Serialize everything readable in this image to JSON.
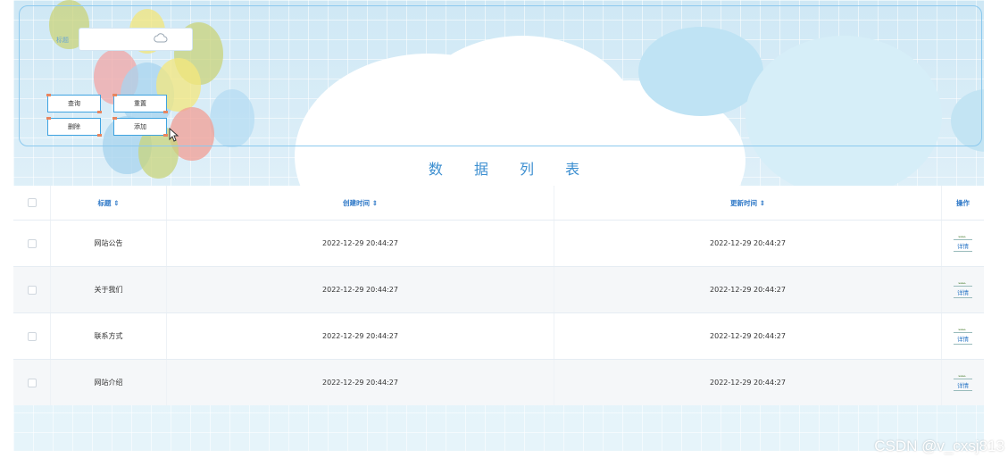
{
  "search": {
    "title_label": "标题",
    "title_value": "",
    "query_label": "查询",
    "reset_label": "重置",
    "delete_label": "删除",
    "add_label": "添加"
  },
  "list": {
    "heading": "数 据 列 表",
    "columns": {
      "title": "标题 ⇕",
      "created": "创建时间 ⇕",
      "updated": "更新时间 ⇕",
      "action": "操作"
    },
    "detail_label": "详情",
    "rows": [
      {
        "title": "网站公告",
        "created": "2022-12-29 20:44:27",
        "updated": "2022-12-29 20:44:27"
      },
      {
        "title": "关于我们",
        "created": "2022-12-29 20:44:27",
        "updated": "2022-12-29 20:44:27"
      },
      {
        "title": "联系方式",
        "created": "2022-12-29 20:44:27",
        "updated": "2022-12-29 20:44:27"
      },
      {
        "title": "网站介绍",
        "created": "2022-12-29 20:44:27",
        "updated": "2022-12-29 20:44:27"
      }
    ]
  },
  "watermark": "CSDN @v_cxsj813",
  "colors": {
    "accent": "#3fa3e0",
    "heading": "#3b8ed0",
    "button_corner": "#e8855f"
  }
}
